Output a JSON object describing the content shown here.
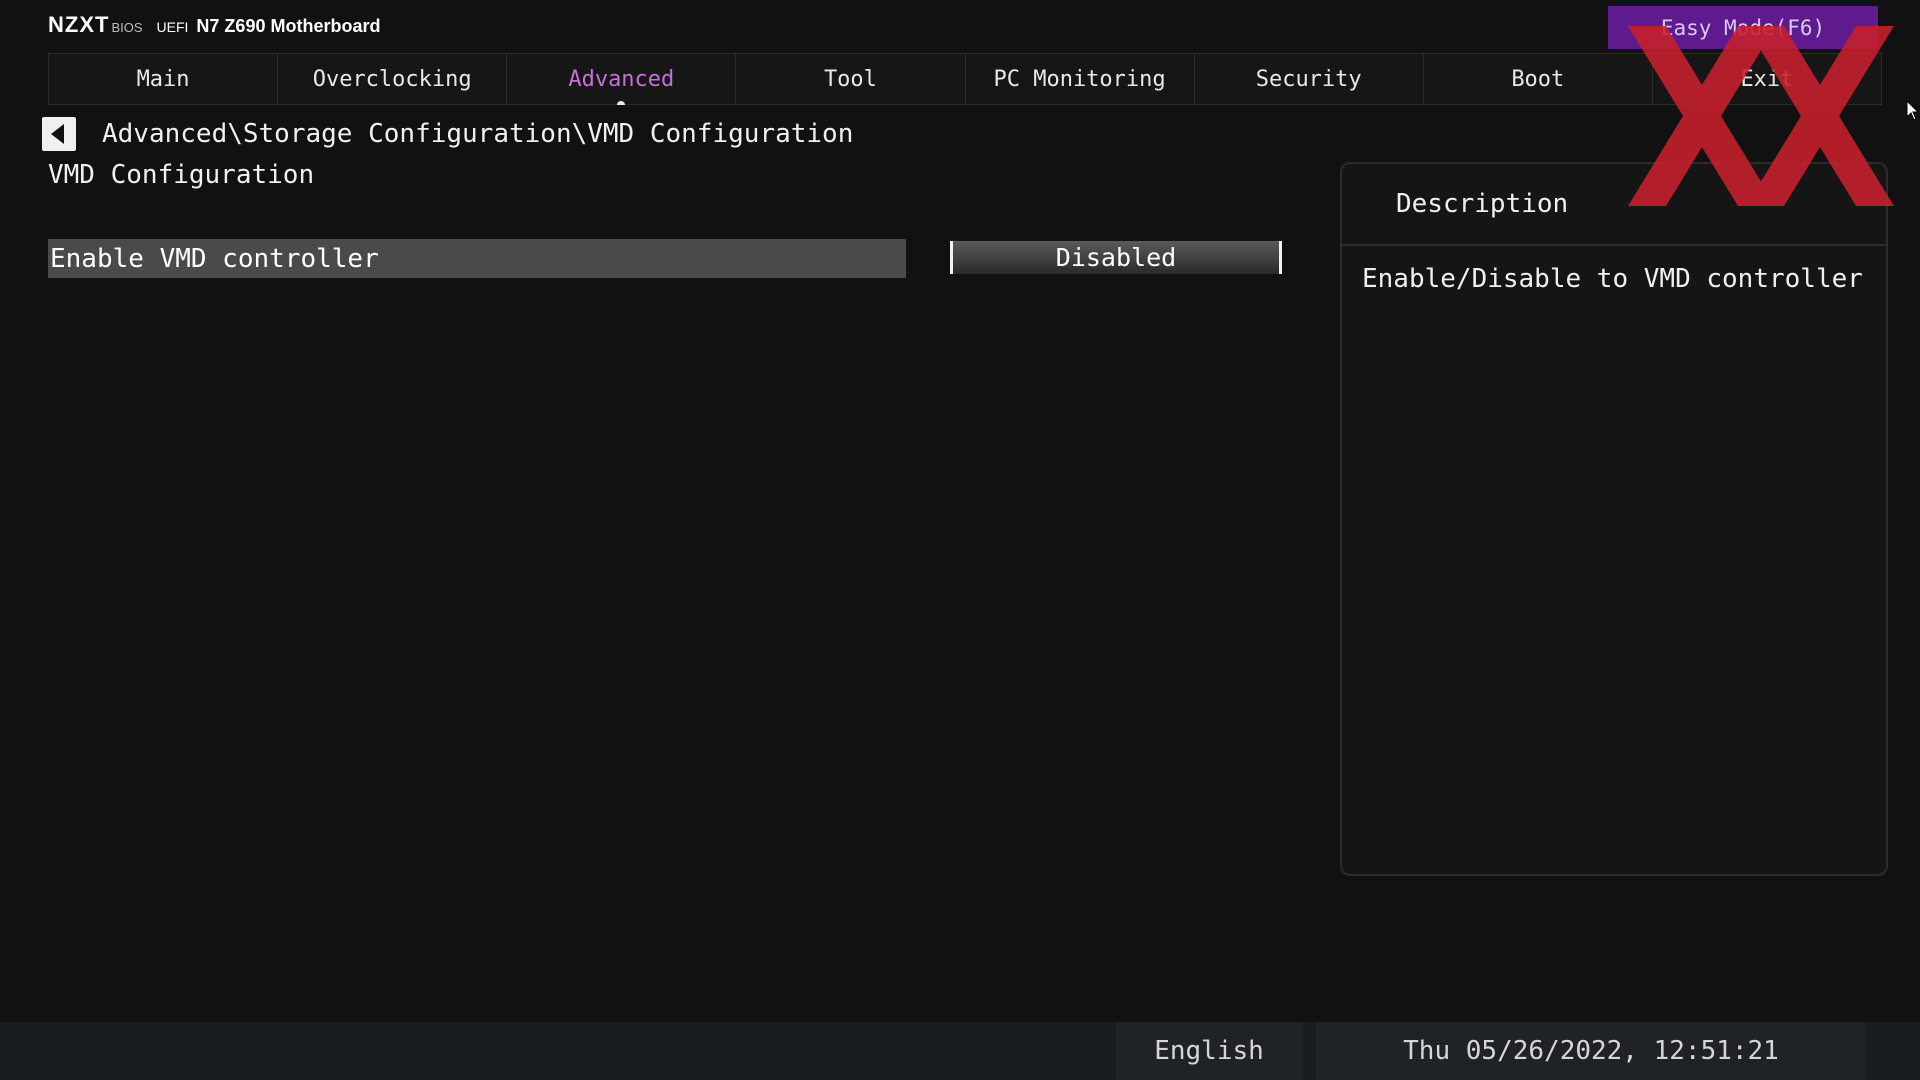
{
  "header": {
    "brand": "NZXT",
    "bios_label": "BIOS",
    "uefi_label": "UEFI",
    "model": "N7 Z690 Motherboard",
    "easy_mode": "Easy Mode(F6)"
  },
  "tabs": [
    {
      "label": "Main"
    },
    {
      "label": "Overclocking"
    },
    {
      "label": "Advanced",
      "active": true
    },
    {
      "label": "Tool"
    },
    {
      "label": "PC Monitoring"
    },
    {
      "label": "Security"
    },
    {
      "label": "Boot"
    },
    {
      "label": "Exit"
    }
  ],
  "breadcrumb": "Advanced\\Storage Configuration\\VMD Configuration",
  "page_title": "VMD Configuration",
  "settings": [
    {
      "label": "Enable VMD controller",
      "value": "Disabled"
    }
  ],
  "description": {
    "title": "Description",
    "text": "Enable/Disable to VMD controller"
  },
  "footer": {
    "language": "English",
    "datetime": "Thu 05/26/2022, 12:51:21"
  },
  "colors": {
    "accent_tab": "#c66fd9",
    "easy_mode_bg": "#5f1a8e",
    "watermark": "#c8202c"
  }
}
